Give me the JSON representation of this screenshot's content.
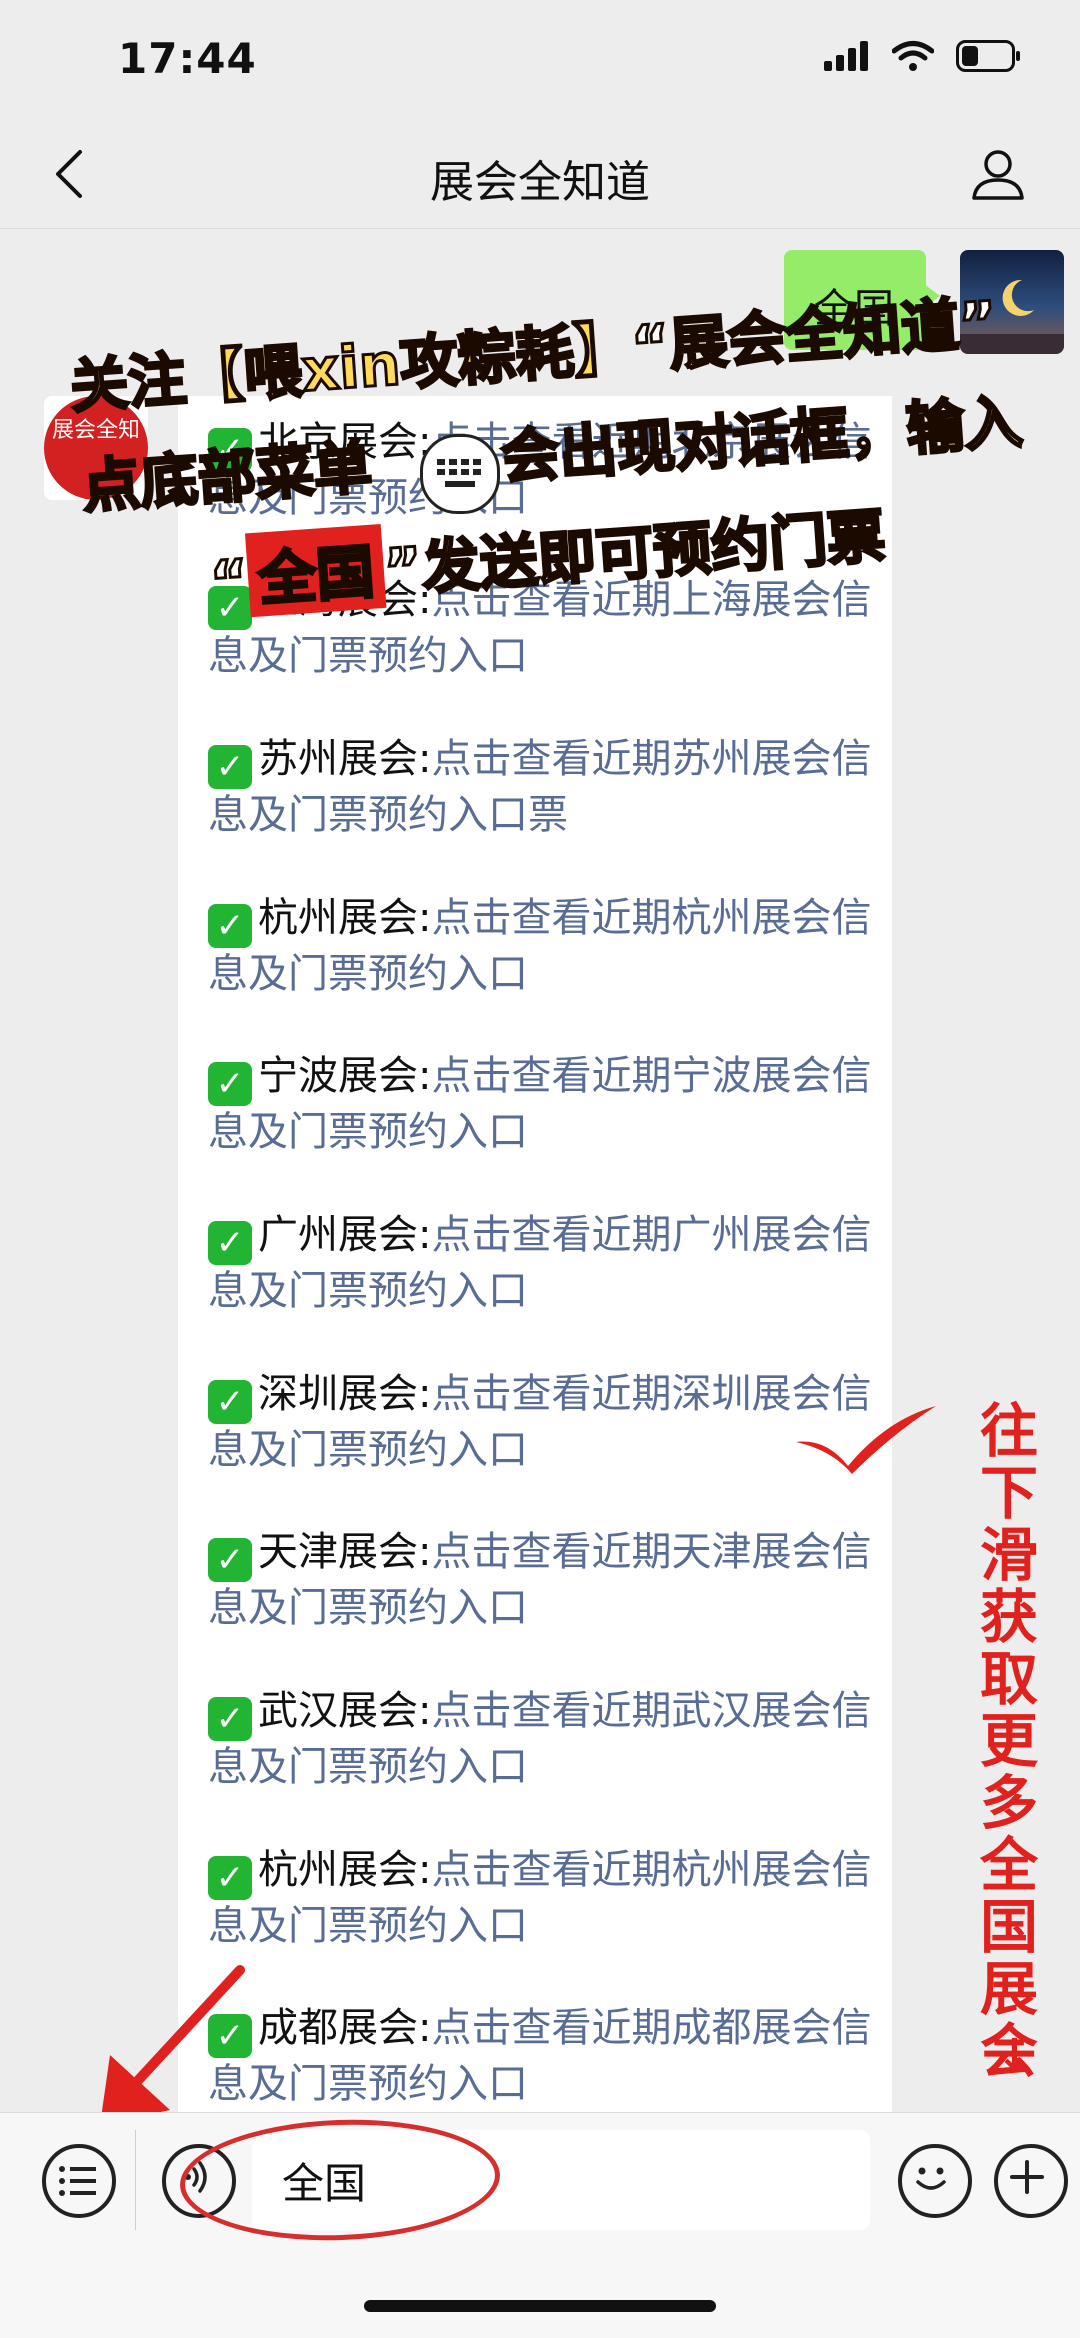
{
  "status_bar": {
    "time": "17:44"
  },
  "nav": {
    "title": "展会全知道"
  },
  "sent_message": {
    "text": "全国"
  },
  "left_avatar": {
    "text": "展会全知"
  },
  "promo": {
    "line1_prefix": "关注",
    "line1_account": "【喂xin攻粽耗】",
    "line1_suffix": "“展会全知道”",
    "line2": "点底部菜单",
    "line2_suffix": "会出现对话框，输入",
    "line3_open": "“",
    "line3_word": "全国",
    "line3_close": "”",
    "line3_suffix": "发送即可预约门票"
  },
  "message_items": [
    {
      "city": "北京展会:",
      "link": "点击查看近期北京展会信息及门票预约入口"
    },
    {
      "city": "上海展会:",
      "link": "点击查看近期上海展会信息及门票预约入口"
    },
    {
      "city": "苏州展会:",
      "link": "点击查看近期苏州展会信息及门票预约入口票"
    },
    {
      "city": "杭州展会:",
      "link": "点击查看近期杭州展会信息及门票预约入口"
    },
    {
      "city": "宁波展会:",
      "link": "点击查看近期宁波展会信息及门票预约入口"
    },
    {
      "city": "广州展会:",
      "link": "点击查看近期广州展会信息及门票预约入口"
    },
    {
      "city": "深圳展会:",
      "link": "点击查看近期深圳展会信息及门票预约入口"
    },
    {
      "city": "天津展会:",
      "link": "点击查看近期天津展会信息及门票预约入口"
    },
    {
      "city": "武汉展会:",
      "link": "点击查看近期武汉展会信息及门票预约入口"
    },
    {
      "city": "杭州展会:",
      "link": "点击查看近期杭州展会信息及门票预约入口"
    },
    {
      "city": "成都展会:",
      "link": "点击查看近期成都展会信息及门票预约入口"
    }
  ],
  "side_annotation": {
    "text": "往下滑获取更多全国展会",
    "arrow": "↓"
  },
  "input_bar": {
    "value": "全国"
  }
}
